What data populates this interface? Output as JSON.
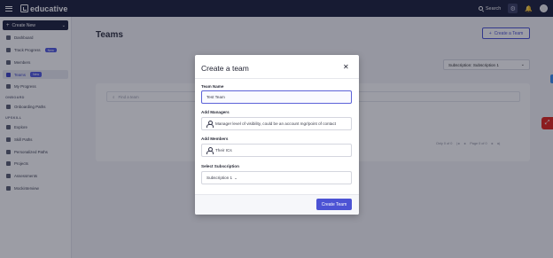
{
  "topbar": {
    "logo_text": "educative",
    "search_label": "Search",
    "icons": [
      "menu-icon",
      "search-icon",
      "settings-icon",
      "bell-icon",
      "avatar"
    ]
  },
  "sidebar": {
    "create_label": "Create New",
    "items": [
      {
        "label": "Dashboard",
        "icon": "dashboard-icon"
      },
      {
        "label": "Track Progress",
        "icon": "progress-icon",
        "badge": "New"
      },
      {
        "label": "Members",
        "icon": "members-icon"
      },
      {
        "label": "Teams",
        "icon": "teams-icon",
        "badge": "New",
        "active": true
      },
      {
        "label": "My Progress",
        "icon": "my-progress-icon"
      }
    ],
    "onboard_label": "ONBOARD",
    "onboard_items": [
      {
        "label": "Onboarding Paths",
        "icon": "onboarding-icon"
      }
    ],
    "upskill_label": "UPSKILL",
    "upskill_items": [
      {
        "label": "Explore",
        "icon": "explore-icon"
      },
      {
        "label": "Skill Paths",
        "icon": "skill-paths-icon"
      },
      {
        "label": "Personalized Paths",
        "icon": "personalized-paths-icon"
      },
      {
        "label": "Projects",
        "icon": "projects-icon"
      },
      {
        "label": "Assessments",
        "icon": "assessments-icon"
      },
      {
        "label": "Mockinterview",
        "icon": "mock-interview-icon"
      }
    ]
  },
  "main": {
    "title": "Teams",
    "create_team_label": "Create a Team",
    "subscription_label": "Subscription: Subscription 1",
    "find_placeholder": "Find a team",
    "pager_text": "Only 0 of 0",
    "page_text": "Page 0 of 0"
  },
  "modal": {
    "title": "Create a team",
    "team_name_label": "Team Name",
    "team_name_value": "Test Team",
    "managers_label": "Add Managers",
    "managers_placeholder": "Manager level of visibility, could be an account mgr/point of contact",
    "members_label": "Add Members",
    "members_placeholder": "Their ICs",
    "subscription_label": "Select Subscription",
    "subscription_value": "Subscription 1",
    "submit_label": "Create Team"
  },
  "colors": {
    "topbar": "#1b1f3b",
    "accent": "#4c53d4",
    "badge": "#5058e0",
    "widget_red": "#e2231a"
  }
}
